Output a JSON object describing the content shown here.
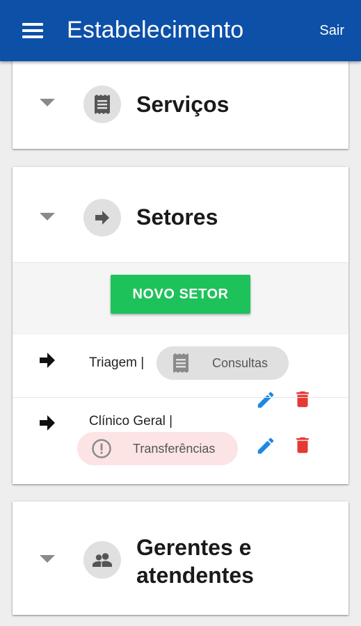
{
  "appbar": {
    "title": "Estabelecimento",
    "logout_label": "Sair"
  },
  "sections": {
    "servicos": {
      "title": "Serviços"
    },
    "setores": {
      "title": "Setores",
      "new_button_label": "NOVO SETOR",
      "items": [
        {
          "name": "Triagem |",
          "chip_label": "Consultas"
        },
        {
          "name": "Clínico Geral |",
          "chip_label": "Transferências"
        }
      ]
    },
    "gerentes": {
      "title_line1": "Gerentes e",
      "title_line2": "atendentes"
    }
  },
  "colors": {
    "appbar": "#0d50a8",
    "new_button": "#1ec25a",
    "edit_icon": "#1e88e5",
    "delete_icon": "#e53935",
    "warning_chip": "#fce4e4"
  },
  "icons": [
    "menu-icon",
    "receipt-icon",
    "arrow-right-icon",
    "people-icon",
    "edit-icon",
    "delete-icon",
    "alert-circle-icon",
    "chevron-down-icon"
  ]
}
